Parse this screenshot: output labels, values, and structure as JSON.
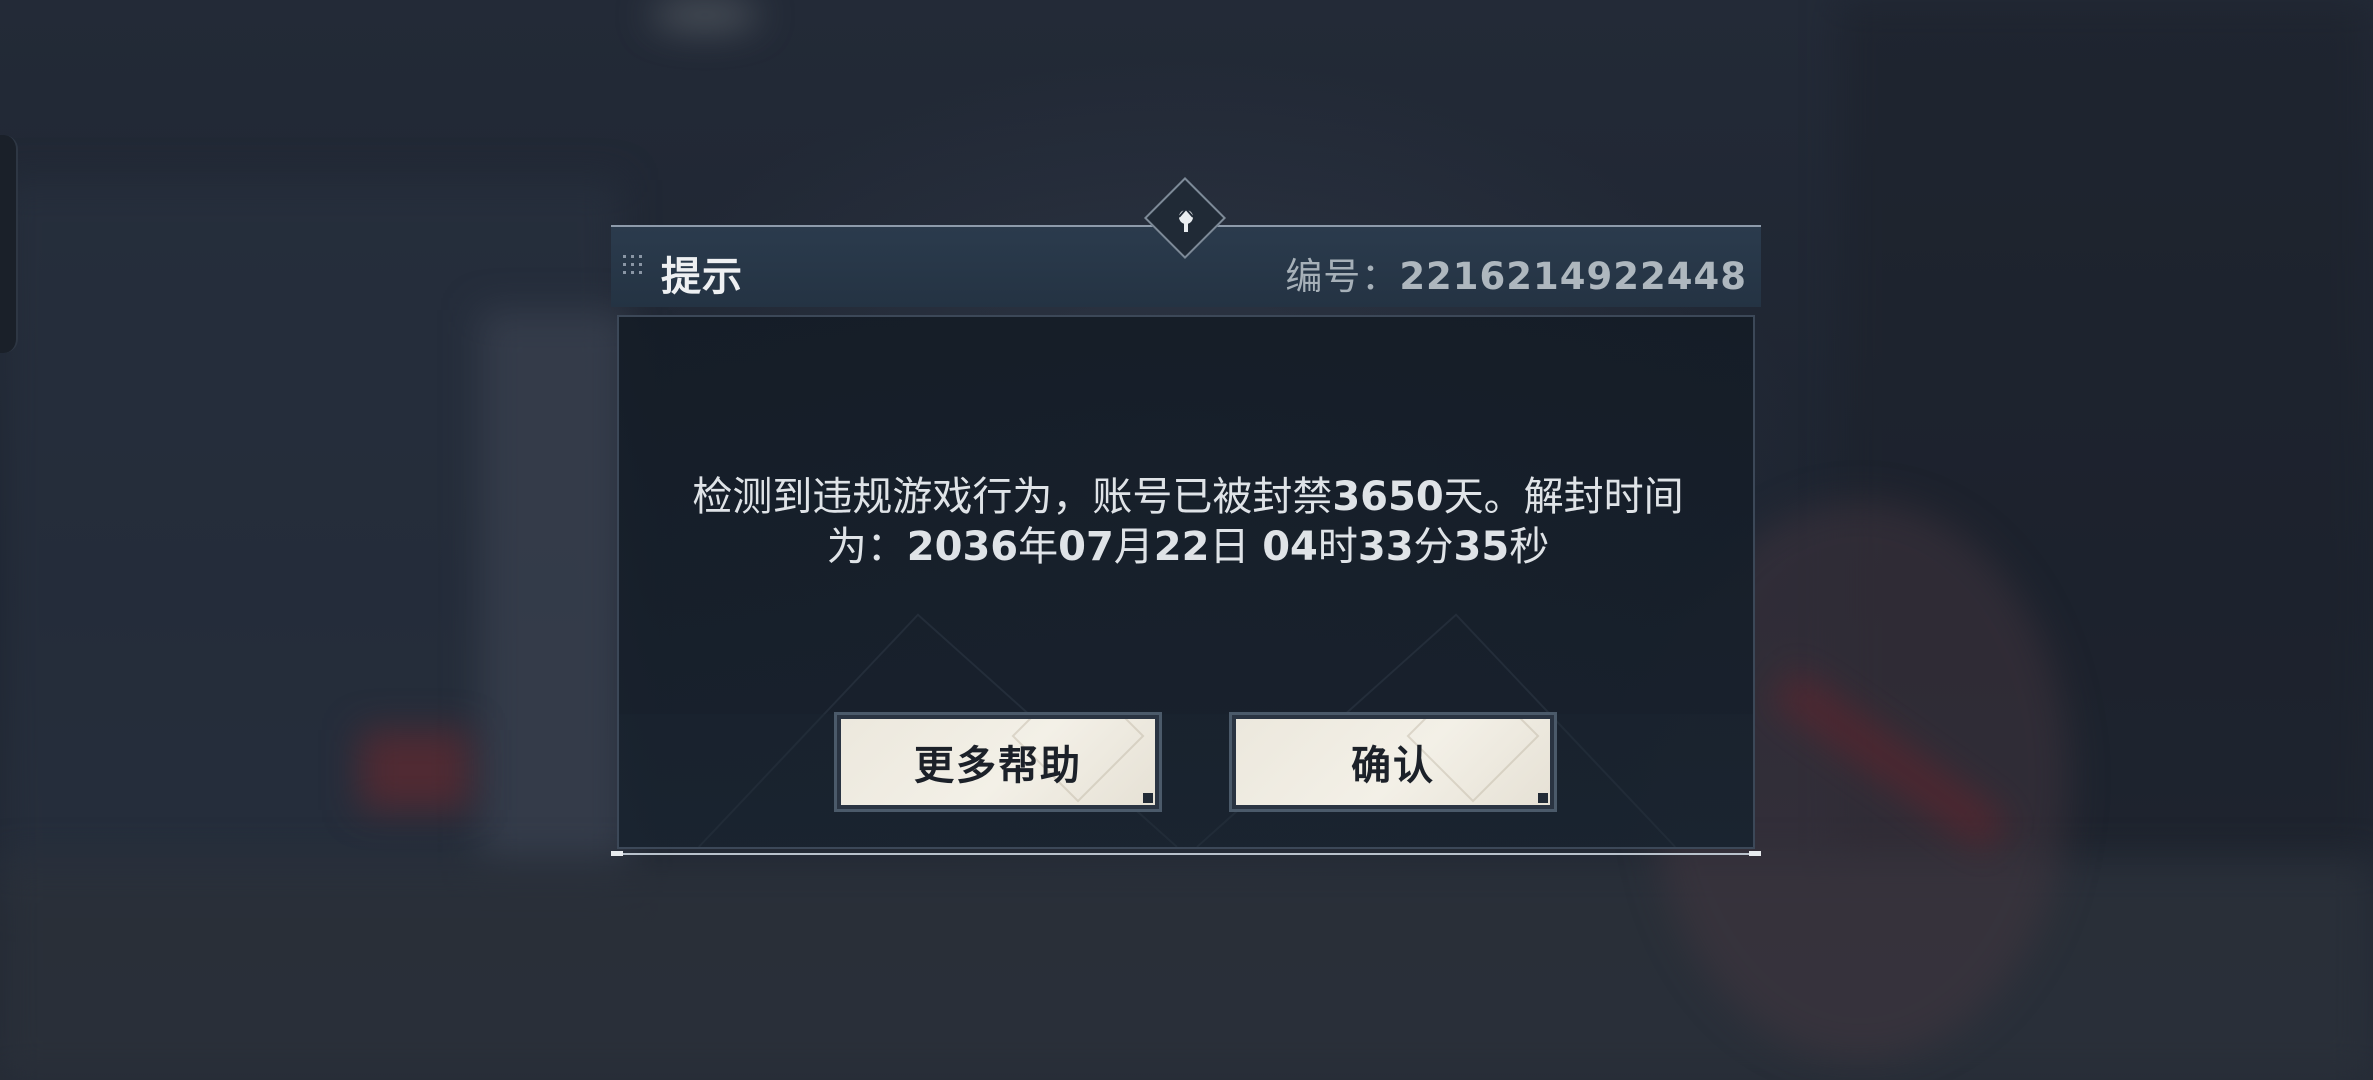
{
  "dialog": {
    "title": "提示",
    "serial_label": "编号：",
    "serial_value": "2216214922448",
    "message_line1_prefix": "检测到违规游戏行为，账号已被封禁",
    "ban_days": "3650",
    "message_line1_suffix": "天。解封时间",
    "message_line2_prefix": "为：",
    "unban_year": "2036",
    "unit_year": "年",
    "unban_month": "07",
    "unit_month": "月",
    "unban_day": "22",
    "unit_day": "日",
    "unban_hour": "04",
    "unit_hour": "时",
    "unban_minute": "33",
    "unit_minute": "分",
    "unban_second": "35",
    "unit_second": "秒",
    "buttons": {
      "help_label": "更多帮助",
      "confirm_label": "确认"
    }
  },
  "colors": {
    "header_bg": "#243343",
    "body_bg": "#18212d",
    "button_bg": "#f3f0e7",
    "text_light": "#dfe3e7",
    "text_dark": "#1c2129"
  },
  "icons": [
    "grip-icon",
    "emblem-icon"
  ]
}
